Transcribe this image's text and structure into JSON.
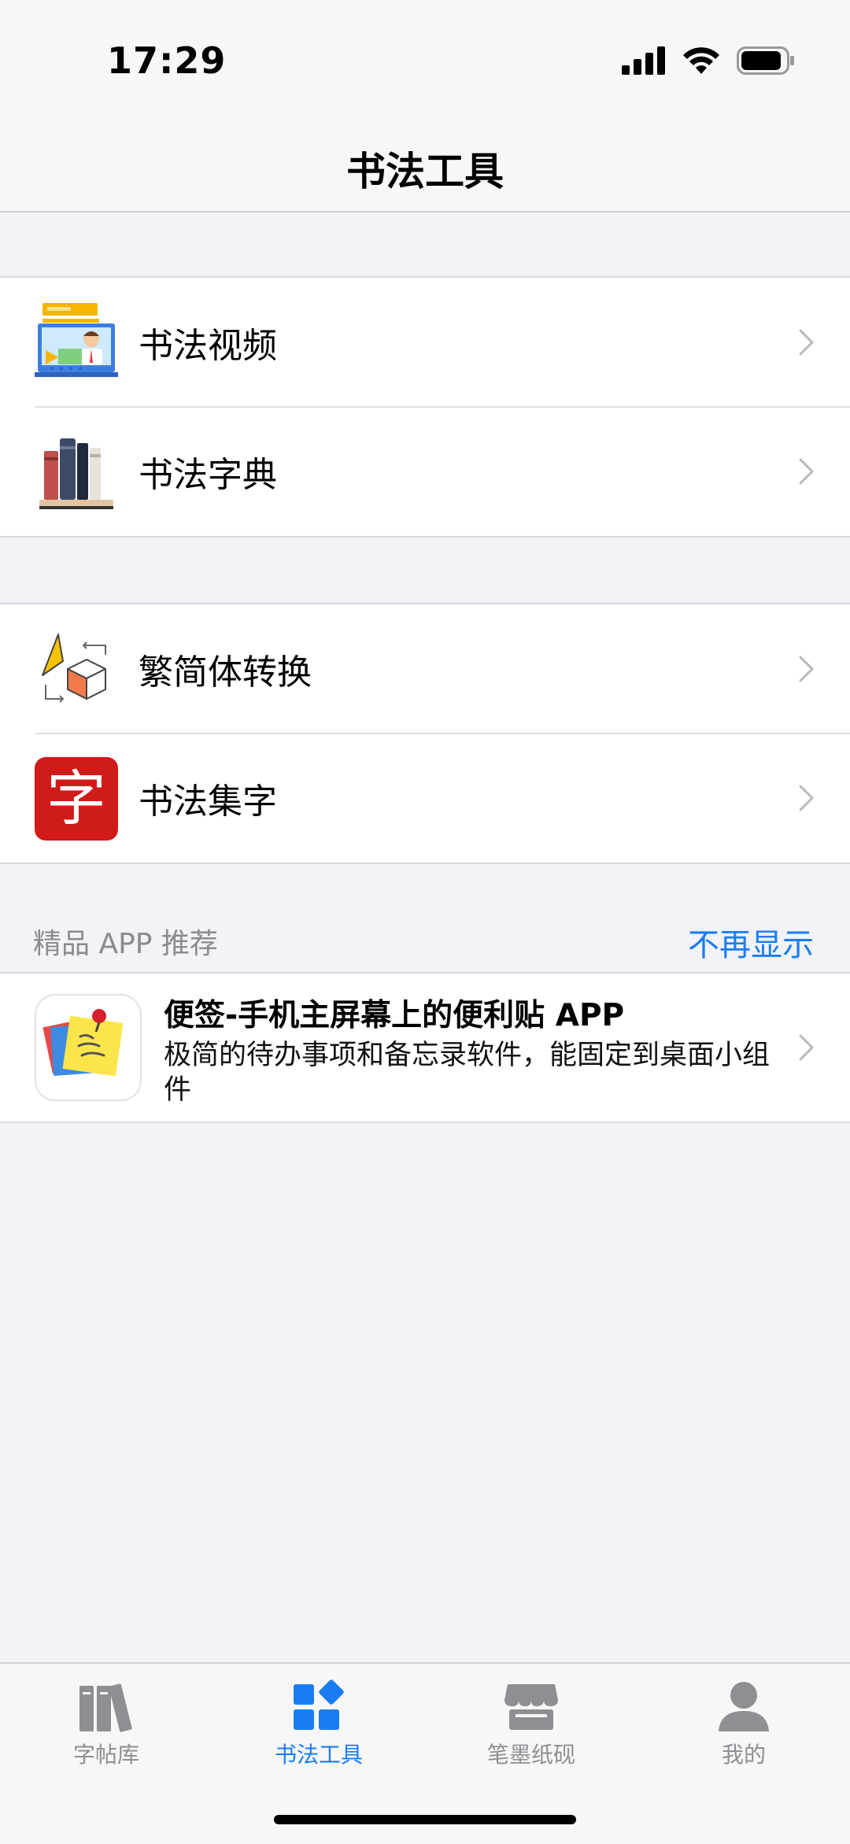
{
  "status_bar": {
    "time": "17:29"
  },
  "nav": {
    "title": "书法工具"
  },
  "groups": [
    {
      "items": [
        {
          "label": "书法视频",
          "icon": "video-lesson-icon"
        },
        {
          "label": "书法字典",
          "icon": "books-icon"
        }
      ]
    },
    {
      "items": [
        {
          "label": "繁简体转换",
          "icon": "shape-convert-icon"
        },
        {
          "label": "书法集字",
          "icon": "zi-character-icon",
          "icon_text": "字"
        }
      ]
    }
  ],
  "recommend": {
    "title": "精品 APP 推荐",
    "hide_label": "不再显示",
    "app": {
      "title": "便签-手机主屏幕上的便利贴 APP",
      "description": "极简的待办事项和备忘录软件，能固定到桌面小组件",
      "icon": "sticky-notes-icon"
    }
  },
  "tabs": [
    {
      "label": "字帖库",
      "icon": "library-icon",
      "active": false
    },
    {
      "label": "书法工具",
      "icon": "tools-grid-icon",
      "active": true
    },
    {
      "label": "笔墨纸砚",
      "icon": "store-icon",
      "active": false
    },
    {
      "label": "我的",
      "icon": "person-icon",
      "active": false
    }
  ],
  "colors": {
    "accent": "#1a7cf2",
    "background": "#f2f2f7",
    "inactive_tab": "#8e8e93"
  }
}
